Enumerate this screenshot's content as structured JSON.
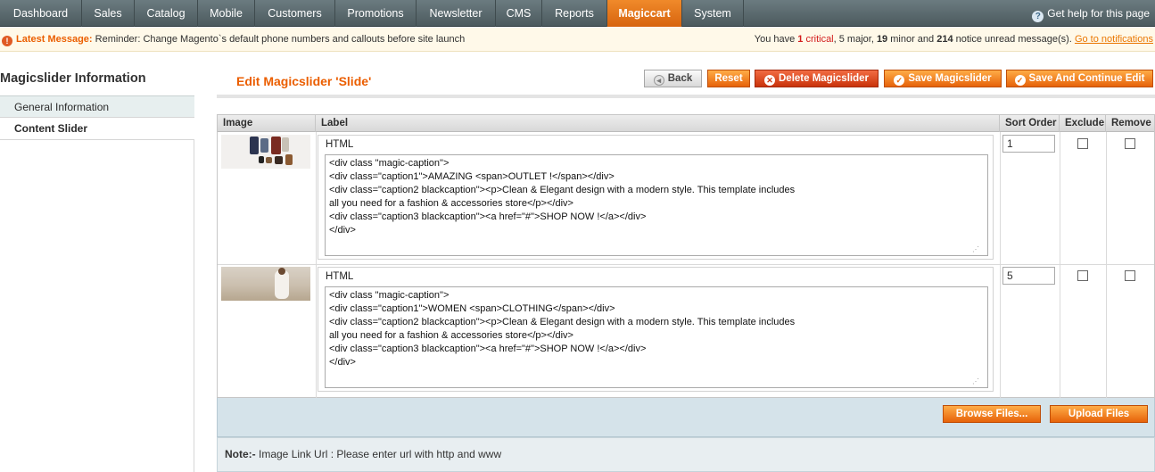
{
  "nav": {
    "items": [
      "Dashboard",
      "Sales",
      "Catalog",
      "Mobile",
      "Customers",
      "Promotions",
      "Newsletter",
      "CMS",
      "Reports",
      "Magiccart",
      "System"
    ],
    "active": "Magiccart",
    "help": "Get help for this page"
  },
  "message": {
    "label": "Latest Message:",
    "text": "Reminder: Change Magento`s default phone numbers and callouts before site launch",
    "summary_prefix": "You have ",
    "critical_count": "1",
    "critical_word": " critical",
    "major": ", 5 major, ",
    "minor_count": "19",
    "minor_word": " minor and ",
    "notice_count": "214",
    "notice_word": " notice unread message(s). ",
    "link": "Go to notifications"
  },
  "sidebar": {
    "title": "Magicslider Information",
    "tabs": [
      "General Information",
      "Content Slider"
    ]
  },
  "header": {
    "title": "Edit Magicslider 'Slide'",
    "buttons": {
      "back": "Back",
      "reset": "Reset",
      "delete": "Delete Magicslider",
      "save": "Save Magicslider",
      "save_continue": "Save And Continue Edit"
    }
  },
  "grid": {
    "columns": [
      "Image",
      "Label",
      "Sort Order",
      "Exclude",
      "Remove"
    ],
    "rows": [
      {
        "html_label": "HTML",
        "code": "<div class \"magic-caption\">\n<div class=\"caption1\">AMAZING <span>OUTLET !</span></div>\n<div class=\"caption2 blackcaption\"><p>Clean & Elegant design with a modern style. This template includes\nall you need for a fashion & accessories store</p></div>\n<div class=\"caption3 blackcaption\"><a href=\"#\">SHOP NOW !</a></div>\n</div>",
        "sort_order": "1"
      },
      {
        "html_label": "HTML",
        "code": "<div class \"magic-caption\">\n<div class=\"caption1\">WOMEN <span>CLOTHING</span></div>\n<div class=\"caption2 blackcaption\"><p>Clean & Elegant design with a modern style. This template includes\nall you need for a fashion & accessories store</p></div>\n<div class=\"caption3 blackcaption\"><a href=\"#\">SHOP NOW !</a></div>\n</div>",
        "sort_order": "5"
      }
    ]
  },
  "upload": {
    "browse": "Browse Files...",
    "upload": "Upload Files"
  },
  "note": {
    "label": "Note:-",
    "text": " Image Link Url : Please enter url with http and www"
  },
  "colors": {
    "accent": "#eb5e00",
    "nav_active": "#e6700f",
    "nav_bg": "#5b6a6e"
  }
}
